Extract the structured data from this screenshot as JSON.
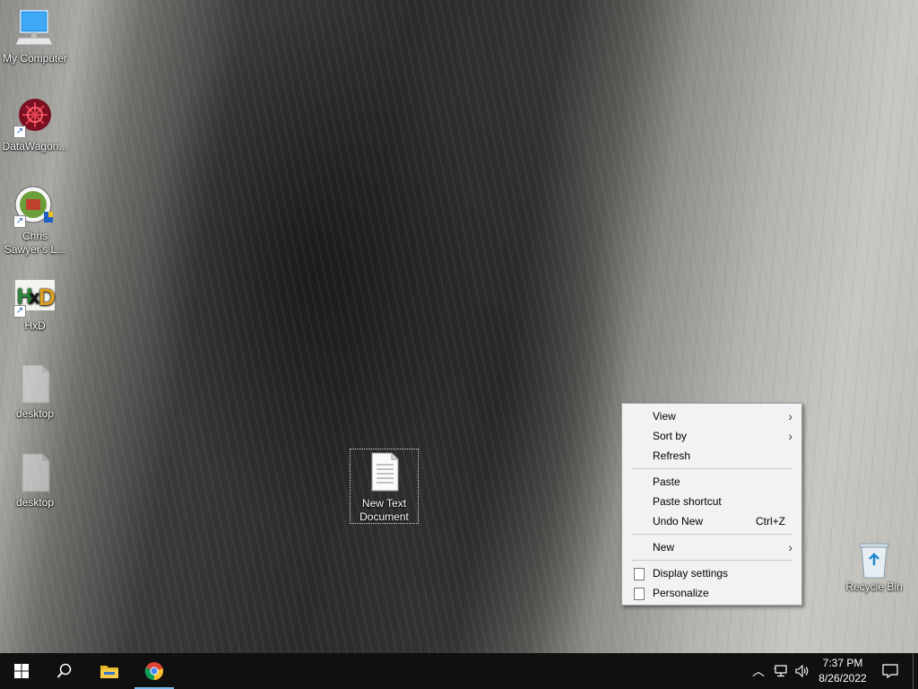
{
  "desktop_icons": [
    {
      "label": "My Computer",
      "icon": "computer-icon"
    },
    {
      "label": "DataWagon...",
      "icon": "datawagon-icon"
    },
    {
      "label": "Chris Sawyer's L...",
      "icon": "game-icon"
    },
    {
      "label": "HxD",
      "icon": "hxd-icon"
    },
    {
      "label": "desktop",
      "icon": "file-icon"
    },
    {
      "label": "desktop",
      "icon": "file-icon"
    },
    {
      "label": "New Text Document",
      "icon": "text-document-icon"
    },
    {
      "label": "Recycle Bin",
      "icon": "recycle-bin-icon"
    }
  ],
  "context_menu": {
    "view": "View",
    "sort_by": "Sort by",
    "refresh": "Refresh",
    "paste": "Paste",
    "paste_shortcut": "Paste shortcut",
    "undo_new": "Undo New",
    "undo_shortcut": "Ctrl+Z",
    "new": "New",
    "display_settings": "Display settings",
    "personalize": "Personalize"
  },
  "taskbar": {
    "start": "start-icon",
    "search": "search-icon",
    "apps": [
      "file-explorer-icon",
      "chrome-icon"
    ],
    "tray_icons": [
      "chevron-up-icon",
      "network-icon",
      "volume-icon"
    ],
    "time": "7:37 PM",
    "date": "8/26/2022",
    "notification": "action-center-icon"
  },
  "colors": {
    "taskbar_bg": "#101010",
    "active_indicator": "#76b9ed",
    "menu_bg": "#f2f2f2"
  }
}
